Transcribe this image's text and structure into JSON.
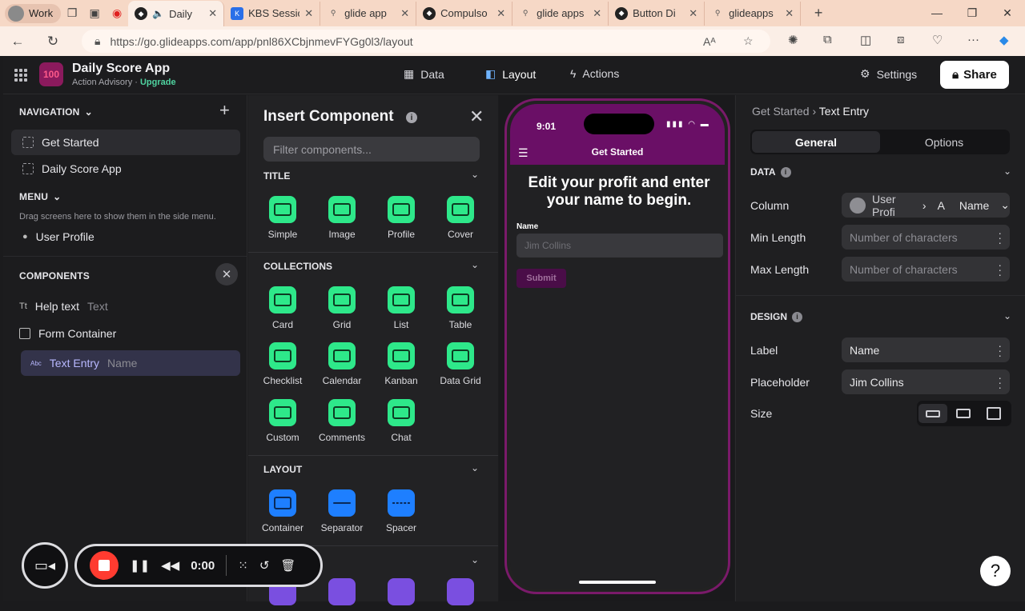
{
  "browser": {
    "profile_label": "Work",
    "tabs": [
      {
        "title": "Daily",
        "favicon": "glide-icon",
        "active": true
      },
      {
        "title": "KBS Sessio",
        "favicon": "kbs-icon"
      },
      {
        "title": "glide app",
        "favicon": "search-icon"
      },
      {
        "title": "Compulso",
        "favicon": "glide-icon"
      },
      {
        "title": "glide apps",
        "favicon": "search-icon"
      },
      {
        "title": "Button Di",
        "favicon": "glide-icon"
      },
      {
        "title": "glideapps",
        "favicon": "search-icon"
      }
    ],
    "url": "https://go.glideapps.com/app/pnl86XCbjnmevFYGg0l3/layout"
  },
  "app": {
    "name": "Daily Score App",
    "org": "Action Advisory",
    "upgrade_label": "Upgrade",
    "logo_text": "100",
    "nav_tabs": [
      {
        "label": "Data",
        "icon": "table-icon"
      },
      {
        "label": "Layout",
        "icon": "layout-icon",
        "selected": true
      },
      {
        "label": "Actions",
        "icon": "lightning-icon"
      }
    ],
    "settings_label": "Settings",
    "share_label": "Share"
  },
  "left_panel": {
    "navigation_header": "NAVIGATION",
    "nav_items": [
      "Get Started",
      "Daily Score App"
    ],
    "menu_header": "MENU",
    "menu_hint": "Drag screens here to show them in the side menu.",
    "menu_items": [
      "User Profile"
    ],
    "components_header": "COMPONENTS",
    "components": [
      {
        "label": "Help text",
        "type": "Text",
        "icon": "Tt"
      },
      {
        "label": "Form Container",
        "type": "",
        "icon": "form-icon"
      },
      {
        "label": "Text Entry",
        "type": "Name",
        "icon": "Abc",
        "selected": true
      }
    ]
  },
  "insert_panel": {
    "title": "Insert Component",
    "filter_placeholder": "Filter components...",
    "categories": [
      {
        "name": "TITLE",
        "items": [
          "Simple",
          "Image",
          "Profile",
          "Cover"
        ]
      },
      {
        "name": "COLLECTIONS",
        "items": [
          "Card",
          "Grid",
          "List",
          "Table",
          "Checklist",
          "Calendar",
          "Kanban",
          "Data Grid",
          "Custom",
          "Comments",
          "Chat"
        ]
      },
      {
        "name": "LAYOUT",
        "items": [
          "Container",
          "Separator",
          "Spacer"
        ]
      }
    ]
  },
  "preview": {
    "time": "9:01",
    "screen_title": "Get Started",
    "headline": "Edit your profit and enter your name to begin.",
    "field_label": "Name",
    "field_placeholder": "Jim Collins",
    "submit_label": "Submit",
    "brand_color": "#6a0f66"
  },
  "right_panel": {
    "breadcrumb_parent": "Get Started",
    "breadcrumb_current": "Text Entry",
    "tabs": [
      "General",
      "Options"
    ],
    "data_header": "DATA",
    "column_label": "Column",
    "column_value_table": "User Profi",
    "column_value_type": "A",
    "column_value_field": "Name",
    "min_length_label": "Min Length",
    "min_length_placeholder": "Number of characters",
    "max_length_label": "Max Length",
    "max_length_placeholder": "Number of characters",
    "design_header": "DESIGN",
    "label_label": "Label",
    "label_value": "Name",
    "placeholder_label": "Placeholder",
    "placeholder_value": "Jim Collins",
    "size_label": "Size"
  },
  "recorder": {
    "time": "0:00"
  }
}
